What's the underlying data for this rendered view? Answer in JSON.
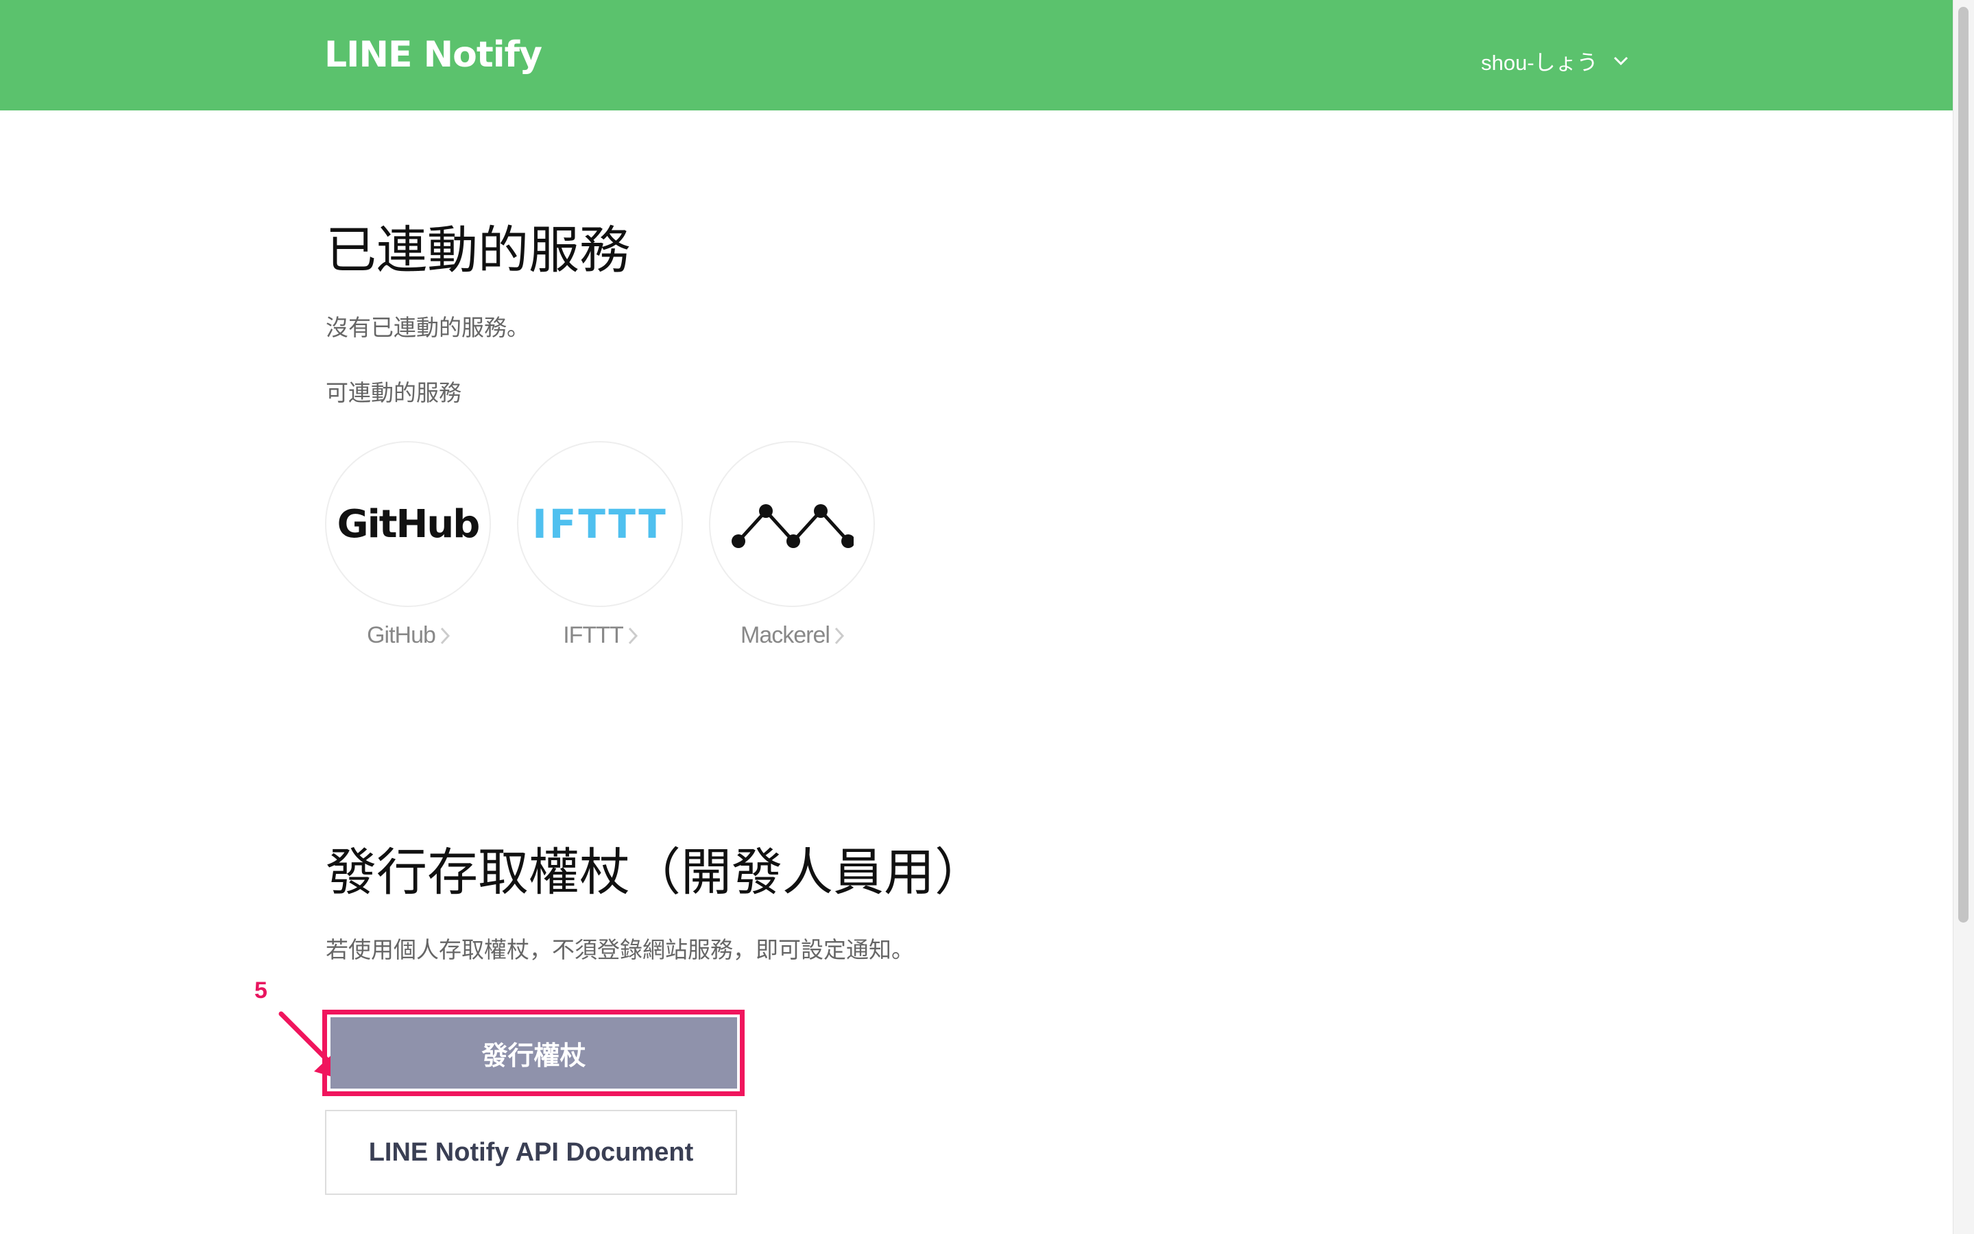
{
  "header": {
    "brand": "LINE Notify",
    "user_name": "shou-しょう",
    "bg_color": "#5bc26d"
  },
  "connected": {
    "title": "已連動的服務",
    "empty_text": "沒有已連動的服務。"
  },
  "available": {
    "title": "可連動的服務",
    "services": [
      {
        "name": "GitHub",
        "logo_text": "GitHub",
        "icon": "github-logo"
      },
      {
        "name": "IFTTT",
        "logo_text": "IFTTT",
        "icon": "ifttt-logo"
      },
      {
        "name": "Mackerel",
        "logo_text": "",
        "icon": "mackerel-logo"
      }
    ]
  },
  "token": {
    "title": "發行存取權杖（開發人員用）",
    "description": "若使用個人存取權杖，不須登錄網站服務，即可設定通知。",
    "issue_button": "發行權杖",
    "doc_button": "LINE Notify API Document",
    "button_color": "#8f92ab"
  },
  "annotation": {
    "step_number": "5",
    "color": "#f0155d"
  }
}
